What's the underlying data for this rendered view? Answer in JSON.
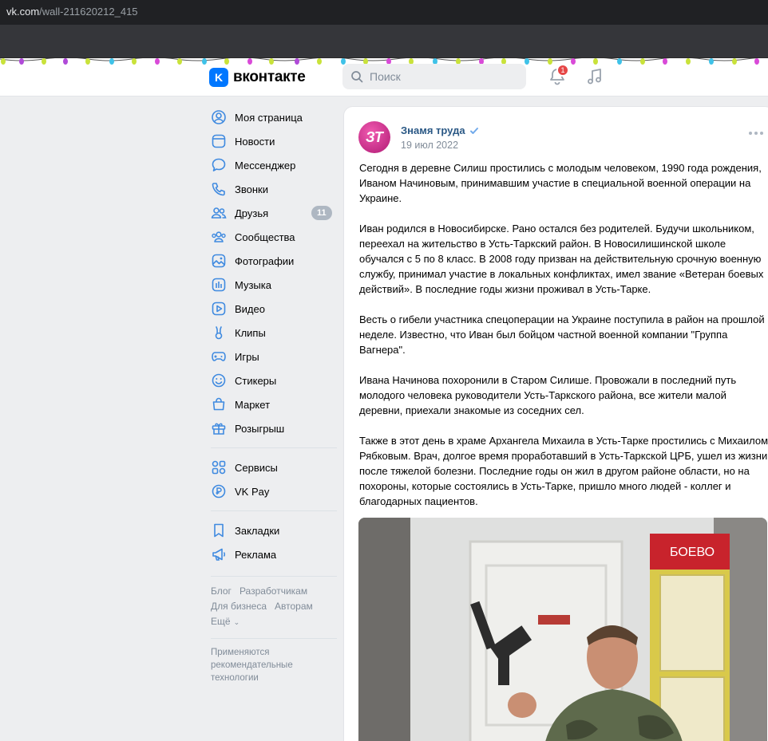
{
  "browser": {
    "url_host": "vk.com",
    "url_path": "/wall-211620212_415"
  },
  "header": {
    "logo_mark": "K",
    "logo_text": "вконтакте",
    "search_placeholder": "Поиск",
    "notifications_count": "1"
  },
  "sidebar": {
    "items": [
      {
        "label": "Моя страница",
        "icon": "user-circle-icon"
      },
      {
        "label": "Новости",
        "icon": "newsfeed-icon"
      },
      {
        "label": "Мессенджер",
        "icon": "message-icon"
      },
      {
        "label": "Звонки",
        "icon": "phone-icon"
      },
      {
        "label": "Друзья",
        "icon": "friends-icon",
        "count": "11"
      },
      {
        "label": "Сообщества",
        "icon": "communities-icon"
      },
      {
        "label": "Фотографии",
        "icon": "photo-icon"
      },
      {
        "label": "Музыка",
        "icon": "music-icon"
      },
      {
        "label": "Видео",
        "icon": "video-icon"
      },
      {
        "label": "Клипы",
        "icon": "clips-icon"
      },
      {
        "label": "Игры",
        "icon": "gamepad-icon"
      },
      {
        "label": "Стикеры",
        "icon": "smile-icon"
      },
      {
        "label": "Маркет",
        "icon": "market-icon"
      },
      {
        "label": "Розыгрыш",
        "icon": "gift-icon"
      }
    ],
    "items2": [
      {
        "label": "Сервисы",
        "icon": "services-icon"
      },
      {
        "label": "VK Pay",
        "icon": "vkpay-icon"
      }
    ],
    "items3": [
      {
        "label": "Закладки",
        "icon": "bookmark-icon"
      },
      {
        "label": "Реклама",
        "icon": "megaphone-icon"
      }
    ],
    "footer": {
      "blog": "Блог",
      "dev": "Разработчикам",
      "biz": "Для бизнеса",
      "authors": "Авторам",
      "more": "Ещё"
    },
    "reco": "Применяются рекомендательные технологии"
  },
  "post": {
    "author": "Знамя труда",
    "avatar_text": "ЗТ",
    "date": "19 июл 2022",
    "paragraphs": [
      "Сегодня в деревне Силиш простились с молодым человеком, 1990 года рождения, Иваном Начиновым, принимавшим участие в специальной военной операции на Украине.",
      "Иван родился в Новосибирске. Рано остался без родителей. Будучи школьником, переехал на жительство в Усть-Таркский район. В Новосилишинской школе обучался с 5 по 8 класс. В 2008 году призван на действительную срочную военную службу, принимал участие в локальных конфликтах, имел звание «Ветеран боевых действий». В последние годы жизни проживал в Усть-Тарке.",
      "Весть о гибели участника спецоперации на Украине поступила в район на прошлой неделе. Известно, что Иван был бойцом частной военной компании \"Группа Вагнера\".",
      "Ивана Начинова похоронили в Старом Силише. Провожали в последний путь молодого человека руководители Усть-Таркского района, все жители малой деревни, приехали знакомые из соседних сел.",
      "Также в этот день в храме Архангела Михаила в Усть-Тарке простились с Михаилом Рябковым. Врач, долгое время проработавший в Усть-Таркской ЦРБ, ушел из жизни после тяжелой болезни. Последние годы он жил в другом районе области, но на похороны, которые состоялись в Усть-Тарке, пришло много людей - коллег и благодарных пациентов."
    ],
    "photo_sign": "БОЕВО"
  },
  "colors": {
    "accent": "#0077ff",
    "link": "#2a5885",
    "icon": "#3f8ae0",
    "badge": "#e64646"
  }
}
